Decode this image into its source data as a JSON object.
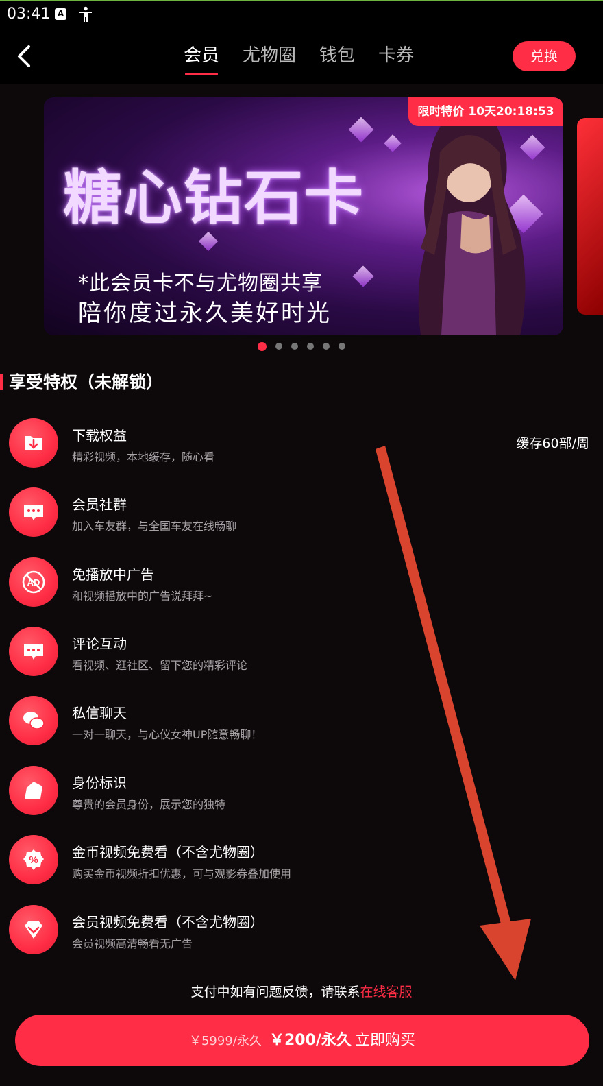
{
  "status_bar": {
    "time": "03:41",
    "icon_a": "A"
  },
  "nav": {
    "tabs": [
      {
        "label": "会员",
        "active": true
      },
      {
        "label": "尤物圈",
        "active": false
      },
      {
        "label": "钱包",
        "active": false
      },
      {
        "label": "卡券",
        "active": false
      }
    ],
    "redeem_label": "兑换"
  },
  "banner": {
    "price_tag": "限时特价 10天20:18:53",
    "title": "糖心钻石卡",
    "subtitle_1": "*此会员卡不与尤物圈共享",
    "subtitle_2": "陪你度过永久美好时光",
    "dot_count": 6,
    "active_dot": 0
  },
  "privileges": {
    "section_title": "享受特权（未解锁）",
    "items": [
      {
        "title": "下载权益",
        "desc": "精彩视频，本地缓存，随心看",
        "extra": "缓存60部/周",
        "icon": "download-icon"
      },
      {
        "title": "会员社群",
        "desc": "加入车友群，与全国车友在线畅聊",
        "icon": "chat-bubble-icon"
      },
      {
        "title": "免播放中广告",
        "desc": "和视频播放中的广告说拜拜~",
        "icon": "no-ad-icon"
      },
      {
        "title": "评论互动",
        "desc": "看视频、逛社区、留下您的精彩评论",
        "icon": "comment-icon"
      },
      {
        "title": "私信聊天",
        "desc": "一对一聊天，与心仪女神UP随意畅聊！",
        "icon": "message-icon"
      },
      {
        "title": "身份标识",
        "desc": "尊贵的会员身份，展示您的独特",
        "icon": "badge-icon"
      },
      {
        "title": "金币视频免费看（不含尤物圈）",
        "desc": "购买金币视频折扣优惠，可与观影券叠加使用",
        "icon": "discount-icon"
      },
      {
        "title": "会员视频免费看（不含尤物圈）",
        "desc": "会员视频高清畅看无广告",
        "icon": "diamond-icon"
      }
    ]
  },
  "help": {
    "text": "支付中如有问题反馈，请联系",
    "link": "在线客服"
  },
  "purchase": {
    "old_price": "￥5999/永久",
    "new_price": "￥200/永久",
    "label": "立即购买"
  },
  "colors": {
    "accent": "#ff2d45",
    "background": "#0d090b",
    "annotation_arrow": "#d9442f"
  }
}
